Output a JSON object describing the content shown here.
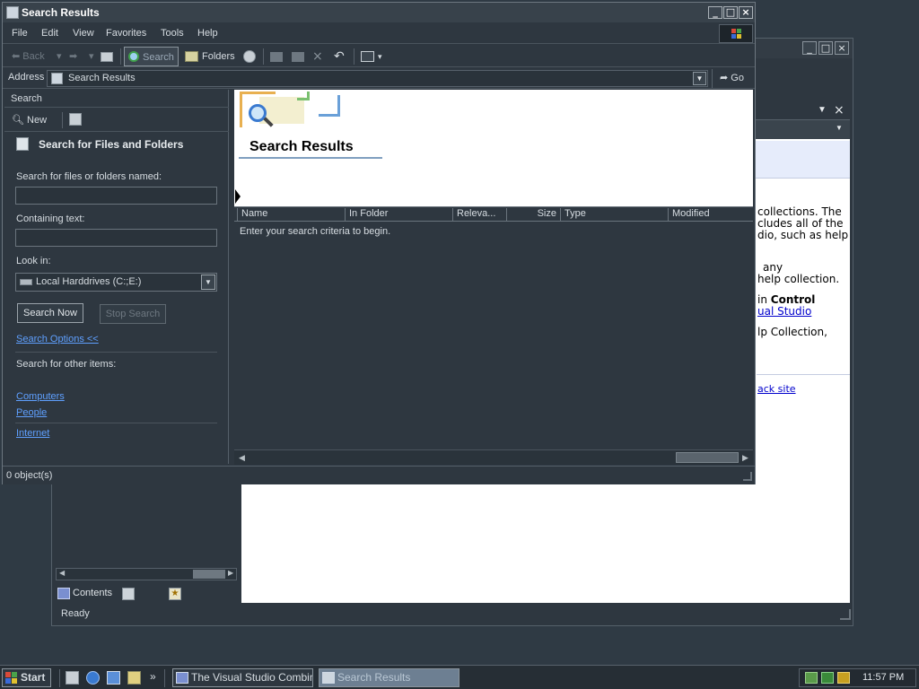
{
  "background_window": {
    "status": "Ready",
    "tabs": {
      "contents": "Contents"
    },
    "content_lines": [
      "collections. The",
      "cludes all of the",
      "dio, such as help",
      "any",
      "help collection.",
      "in",
      "Control",
      "ual Studio",
      "lp Collection,",
      "ack site"
    ]
  },
  "window": {
    "title": "Search Results",
    "menu": [
      "File",
      "Edit",
      "View",
      "Favorites",
      "Tools",
      "Help"
    ],
    "toolbar": {
      "back": "Back",
      "search": "Search",
      "folders": "Folders"
    },
    "address": {
      "label": "Address",
      "value": "Search Results",
      "go": "Go"
    },
    "status": "0 object(s)"
  },
  "search_pane": {
    "header": "Search",
    "new_label": "New",
    "title": "Search for Files and Folders",
    "named_label": "Search for files or folders named:",
    "named_value": "",
    "containing_label": "Containing text:",
    "containing_value": "",
    "look_in_label": "Look in:",
    "look_in_value": "Local Harddrives (C:;E:)",
    "search_now": "Search Now",
    "stop_search": "Stop Search",
    "search_options": "Search Options <<",
    "other_items_label": "Search for other items:",
    "other_items": [
      "Computers",
      "People",
      "Internet"
    ]
  },
  "results": {
    "title": "Search Results",
    "columns": [
      "Name",
      "In Folder",
      "Releva...",
      "Size",
      "Type",
      "Modified"
    ],
    "empty_text": "Enter your search criteria to begin."
  },
  "taskbar": {
    "start": "Start",
    "tasks": [
      "The Visual Studio Combin...",
      "Search Results"
    ],
    "clock": "11:57 PM"
  },
  "colors": {
    "background": "#2f3a44",
    "link": "#5fa0ff",
    "active_task": "#6d7f92"
  }
}
